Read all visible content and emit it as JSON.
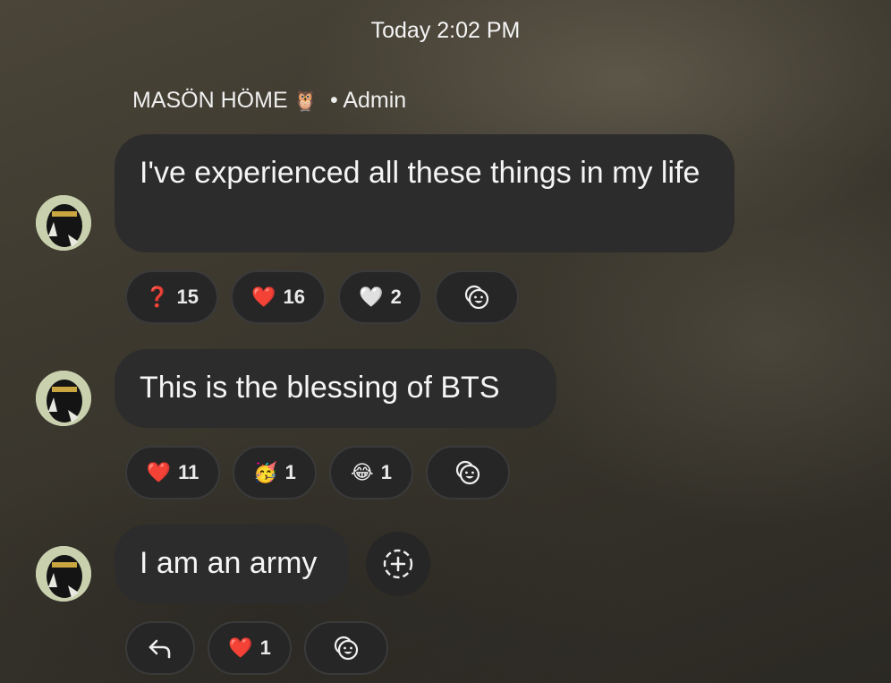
{
  "timestamp": "Today 2:02 PM",
  "sender": {
    "name": "MASÖN HÖME",
    "badge": "🦉",
    "role": "• Admin"
  },
  "messages": [
    {
      "text": "I've experienced all these things in my life",
      "reactions": [
        {
          "emoji": "❓",
          "count": "15"
        },
        {
          "emoji": "❤️",
          "count": "16"
        },
        {
          "emoji": "🤍",
          "count": "2"
        }
      ],
      "add_reaction_icon": "emoji-smile-icon"
    },
    {
      "text": "This is the blessing of BTS",
      "reactions": [
        {
          "emoji": "❤️",
          "count": "11"
        },
        {
          "emoji": "🥳",
          "count": "1"
        },
        {
          "emoji": "😂",
          "count": "1"
        }
      ],
      "add_reaction_icon": "emoji-smile-icon"
    },
    {
      "text": "I am an army",
      "side_action_icon": "add-reaction-circle-icon",
      "reply_icon": "reply-arrow-icon",
      "reactions": [
        {
          "emoji": "❤️",
          "count": "1"
        }
      ],
      "add_reaction_icon": "emoji-smile-icon"
    }
  ]
}
